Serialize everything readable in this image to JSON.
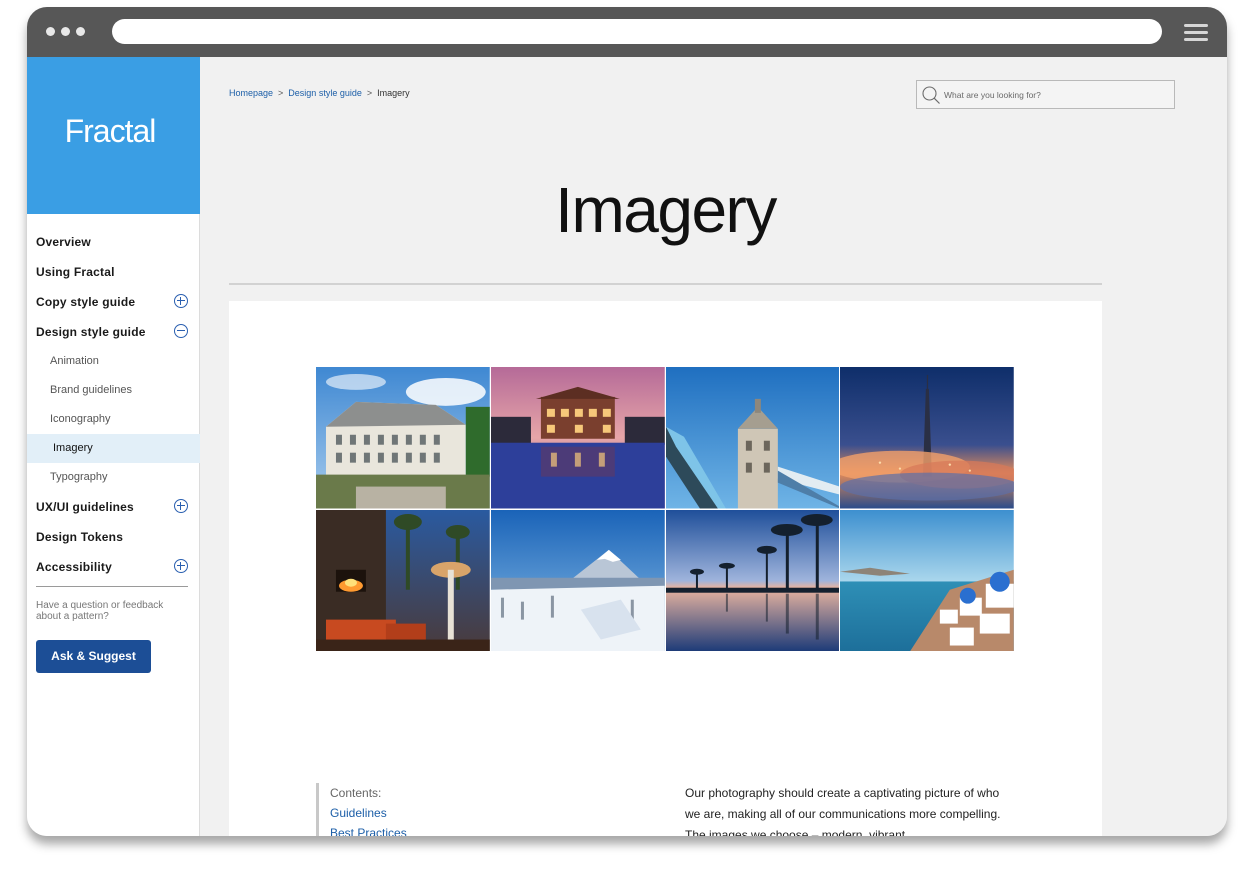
{
  "brand": {
    "logo": "Fractal",
    "color": "#3a9ee4"
  },
  "sidebar": {
    "nav": [
      {
        "label": "Overview",
        "level": 1
      },
      {
        "label": "Using Fractal",
        "level": 1
      },
      {
        "label": "Copy style guide",
        "level": 1,
        "toggle": "expand"
      },
      {
        "label": "Design style guide",
        "level": 1,
        "toggle": "collapse"
      },
      {
        "label": "Animation",
        "level": 2
      },
      {
        "label": "Brand guidelines",
        "level": 2
      },
      {
        "label": "Iconography",
        "level": 2
      },
      {
        "label": "Imagery",
        "level": 2,
        "active": true
      },
      {
        "label": "Typography",
        "level": 2
      },
      {
        "label": "UX/UI guidelines",
        "level": 1,
        "toggle": "expand"
      },
      {
        "label": "Design Tokens",
        "level": 1
      },
      {
        "label": "Accessibility",
        "level": 1,
        "toggle": "expand"
      }
    ],
    "feedback_text": "Have a question or feedback about a pattern?",
    "ask_button": "Ask & Suggest"
  },
  "breadcrumb": {
    "home": "Homepage",
    "parent": "Design style guide",
    "current": "Imagery",
    "separator": ">"
  },
  "search": {
    "placeholder": "What are you looking for?",
    "value": ""
  },
  "page": {
    "title": "Imagery"
  },
  "gallery": [
    {
      "icon": "hotel-photo"
    },
    {
      "icon": "resort-pool-photo"
    },
    {
      "icon": "tower-bridge-photo"
    },
    {
      "icon": "city-skyline-fog-photo"
    },
    {
      "icon": "fireplace-terrace-photo"
    },
    {
      "icon": "snowy-mountain-photo"
    },
    {
      "icon": "palm-infinity-pool-photo"
    },
    {
      "icon": "santorini-coast-photo"
    }
  ],
  "contents": {
    "label": "Contents:",
    "links": [
      "Guidelines",
      "Best Practices"
    ]
  },
  "intro": {
    "text": "Our photography should create a captivating picture of who we are, making all of our communications more compelling. The images we choose – modern, vibrant"
  }
}
